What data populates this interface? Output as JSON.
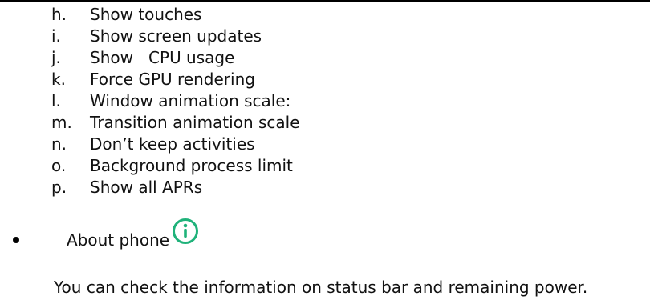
{
  "items": [
    {
      "marker": "h.",
      "text": "Show touches"
    },
    {
      "marker": "i.",
      "text": "Show screen updates"
    },
    {
      "marker": "j.",
      "text": "Show   CPU usage"
    },
    {
      "marker": "k.",
      "text": "Force GPU rendering"
    },
    {
      "marker": "l.",
      "text": "Window animation scale:"
    },
    {
      "marker": "m.",
      "text": "Transition animation scale"
    },
    {
      "marker": "n.",
      "text": "Don’t keep activities"
    },
    {
      "marker": "o.",
      "text": "Background process limit"
    },
    {
      "marker": "p.",
      "text": "Show all APRs"
    }
  ],
  "about": {
    "label": "About phone",
    "icon": "info-icon",
    "icon_color": "#1fb27a",
    "note": "You can check the information on status bar and remaining power."
  }
}
